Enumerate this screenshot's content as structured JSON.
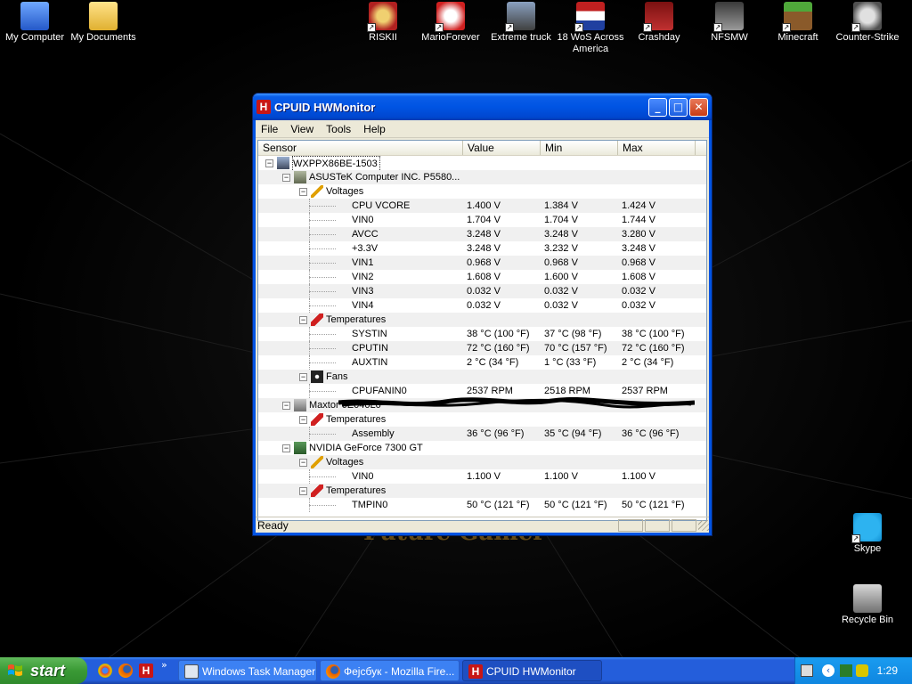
{
  "desktop": {
    "icons": [
      {
        "label": "My Computer",
        "icon": "my-computer-icon"
      },
      {
        "label": "My Documents",
        "icon": "folder-icon"
      },
      {
        "label": "RISKII",
        "icon": "riskii-game-icon"
      },
      {
        "label": "MarioForever",
        "icon": "mario-icon"
      },
      {
        "label": "Extreme truck",
        "icon": "truck-icon"
      },
      {
        "label": "18 WoS Across America",
        "icon": "truck-flag-icon"
      },
      {
        "label": "Crashday",
        "icon": "car-icon"
      },
      {
        "label": "NFSMW",
        "icon": "nfsmw-icon"
      },
      {
        "label": "Minecraft",
        "icon": "minecraft-icon"
      },
      {
        "label": "Counter-Strike",
        "icon": "counter-strike-icon"
      },
      {
        "label": "Skype",
        "icon": "skype-icon"
      },
      {
        "label": "Recycle Bin",
        "icon": "recycle-bin-icon"
      }
    ]
  },
  "window": {
    "title": "CPUID HWMonitor",
    "app_icon_letter": "H",
    "menu": [
      "File",
      "View",
      "Tools",
      "Help"
    ],
    "columns": [
      "Sensor",
      "Value",
      "Min",
      "Max"
    ],
    "rows": [
      {
        "level": 0,
        "kind": "computer",
        "name": "WXPPX86BE-1503",
        "value": "",
        "min": "",
        "max": ""
      },
      {
        "level": 1,
        "kind": "board",
        "name": "ASUSTeK Computer INC. P5580...",
        "value": "",
        "min": "",
        "max": ""
      },
      {
        "level": 2,
        "kind": "voltage",
        "name": "Voltages",
        "value": "",
        "min": "",
        "max": ""
      },
      {
        "level": 3,
        "kind": "leaf",
        "name": "CPU VCORE",
        "value": "1.400 V",
        "min": "1.384 V",
        "max": "1.424 V"
      },
      {
        "level": 3,
        "kind": "leaf",
        "name": "VIN0",
        "value": "1.704 V",
        "min": "1.704 V",
        "max": "1.744 V"
      },
      {
        "level": 3,
        "kind": "leaf",
        "name": "AVCC",
        "value": "3.248 V",
        "min": "3.248 V",
        "max": "3.280 V"
      },
      {
        "level": 3,
        "kind": "leaf",
        "name": "+3.3V",
        "value": "3.248 V",
        "min": "3.232 V",
        "max": "3.248 V"
      },
      {
        "level": 3,
        "kind": "leaf",
        "name": "VIN1",
        "value": "0.968 V",
        "min": "0.968 V",
        "max": "0.968 V"
      },
      {
        "level": 3,
        "kind": "leaf",
        "name": "VIN2",
        "value": "1.608 V",
        "min": "1.600 V",
        "max": "1.608 V"
      },
      {
        "level": 3,
        "kind": "leaf",
        "name": "VIN3",
        "value": "0.032 V",
        "min": "0.032 V",
        "max": "0.032 V"
      },
      {
        "level": 3,
        "kind": "leaf",
        "name": "VIN4",
        "value": "0.032 V",
        "min": "0.032 V",
        "max": "0.032 V"
      },
      {
        "level": 2,
        "kind": "temperature",
        "name": "Temperatures",
        "value": "",
        "min": "",
        "max": ""
      },
      {
        "level": 3,
        "kind": "leaf",
        "name": "SYSTIN",
        "value": "38 °C (100 °F)",
        "min": "37 °C (98 °F)",
        "max": "38 °C (100 °F)"
      },
      {
        "level": 3,
        "kind": "leaf",
        "name": "CPUTIN",
        "value": "72 °C (160 °F)",
        "min": "70 °C (157 °F)",
        "max": "72 °C (160 °F)"
      },
      {
        "level": 3,
        "kind": "leaf",
        "name": "AUXTIN",
        "value": "2 °C (34 °F)",
        "min": "1 °C (33 °F)",
        "max": "2 °C (34 °F)"
      },
      {
        "level": 2,
        "kind": "fan",
        "name": "Fans",
        "value": "",
        "min": "",
        "max": ""
      },
      {
        "level": 3,
        "kind": "leaf",
        "name": "CPUFANIN0",
        "value": "2537 RPM",
        "min": "2518 RPM",
        "max": "2537 RPM"
      },
      {
        "level": 1,
        "kind": "disk",
        "name": "Maxtor 6E040L0",
        "value": "",
        "min": "",
        "max": ""
      },
      {
        "level": 2,
        "kind": "temperature",
        "name": "Temperatures",
        "value": "",
        "min": "",
        "max": ""
      },
      {
        "level": 3,
        "kind": "leaf",
        "name": "Assembly",
        "value": "36 °C (96 °F)",
        "min": "35 °C (94 °F)",
        "max": "36 °C (96 °F)"
      },
      {
        "level": 1,
        "kind": "gpu",
        "name": "NVIDIA GeForce 7300 GT",
        "value": "",
        "min": "",
        "max": ""
      },
      {
        "level": 2,
        "kind": "voltage",
        "name": "Voltages",
        "value": "",
        "min": "",
        "max": ""
      },
      {
        "level": 3,
        "kind": "leaf",
        "name": "VIN0",
        "value": "1.100 V",
        "min": "1.100 V",
        "max": "1.100 V"
      },
      {
        "level": 2,
        "kind": "temperature",
        "name": "Temperatures",
        "value": "",
        "min": "",
        "max": ""
      },
      {
        "level": 3,
        "kind": "leaf",
        "name": "TMPIN0",
        "value": "50 °C (121 °F)",
        "min": "50 °C (121 °F)",
        "max": "50 °C (121 °F)"
      }
    ],
    "status": "Ready"
  },
  "taskbar": {
    "start_label": "start",
    "quicklaunch": [
      "chrome-icon",
      "firefox-icon",
      "hwmonitor-icon"
    ],
    "items": [
      {
        "label": "Windows Task Manager",
        "icon": "task-manager-icon",
        "active": false
      },
      {
        "label": "Фејсбук - Mozilla Fire...",
        "icon": "firefox-icon",
        "active": false
      },
      {
        "label": "CPUID HWMonitor",
        "icon": "hwmonitor-icon",
        "active": true
      }
    ],
    "clock": "1:29"
  },
  "colors": {
    "xp_blue": "#0054e3",
    "taskbar": "#245edb",
    "start_green": "#3a9a35",
    "hwmonitor_red": "#c81616"
  }
}
